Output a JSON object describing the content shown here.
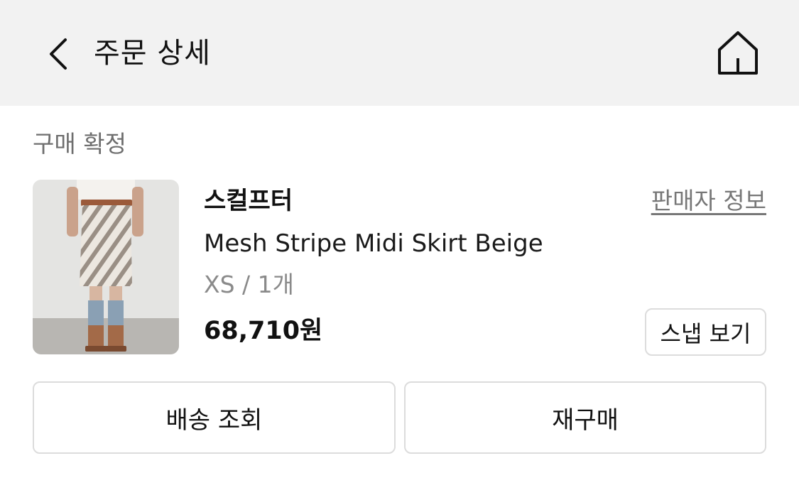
{
  "header": {
    "title": "주문 상세",
    "back_icon": "chevron-left-icon",
    "home_icon": "home-icon",
    "background": "#f2f2f2"
  },
  "order": {
    "status": "구매 확정",
    "item": {
      "brand": "스컬프터",
      "seller_link": "판매자 정보",
      "name": "Mesh Stripe Midi Skirt Beige",
      "option": "XS / 1개",
      "price": "68,710원",
      "snap_button": "스냅 보기",
      "image": "product-photo"
    }
  },
  "actions": {
    "track_delivery": "배송 조회",
    "reorder": "재구매"
  },
  "colors": {
    "text": "#111111",
    "muted": "#6e6e6e",
    "border": "#dcdcdc"
  }
}
